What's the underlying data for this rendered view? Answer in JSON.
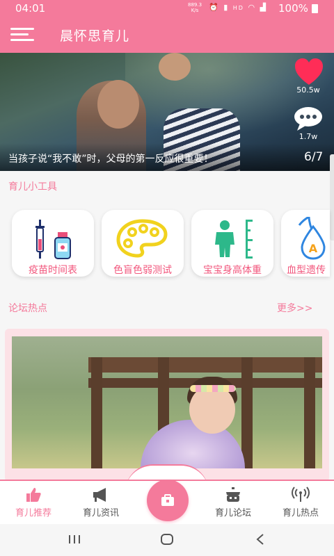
{
  "status_bar": {
    "time": "04:01",
    "net_speed_value": "889.3",
    "net_speed_unit": "K/s",
    "battery": "100%"
  },
  "header": {
    "title": "晨怀思育儿"
  },
  "hero": {
    "caption": "当孩子说“我不敢”时，父母的第一反应很重要！",
    "counter": "6/7",
    "like_count": "50.5w",
    "comment_count": "1.7w"
  },
  "tools": {
    "title": "育儿小工具",
    "items": [
      {
        "label": "疫苗时间表",
        "icon": "vaccine-icon"
      },
      {
        "label": "色盲色弱测试",
        "icon": "palette-icon"
      },
      {
        "label": "宝宝身高体重",
        "icon": "height-icon"
      },
      {
        "label": "血型遗传",
        "icon": "blood-type-icon"
      }
    ]
  },
  "forum": {
    "title": "论坛热点",
    "more": "更多>>"
  },
  "bottom_nav": {
    "items": [
      {
        "label": "育儿推荐",
        "icon": "thumbs-up-icon",
        "active": true
      },
      {
        "label": "育儿资讯",
        "icon": "megaphone-icon",
        "active": false
      },
      {
        "label": "育儿论坛",
        "icon": "pot-icon",
        "active": false
      },
      {
        "label": "育儿热点",
        "icon": "broadcast-icon",
        "active": false
      }
    ],
    "center_icon": "toolbox-icon"
  },
  "colors": {
    "accent": "#f47a9b",
    "accent_text": "#f2577d",
    "forum_bg": "#fce1e6"
  }
}
